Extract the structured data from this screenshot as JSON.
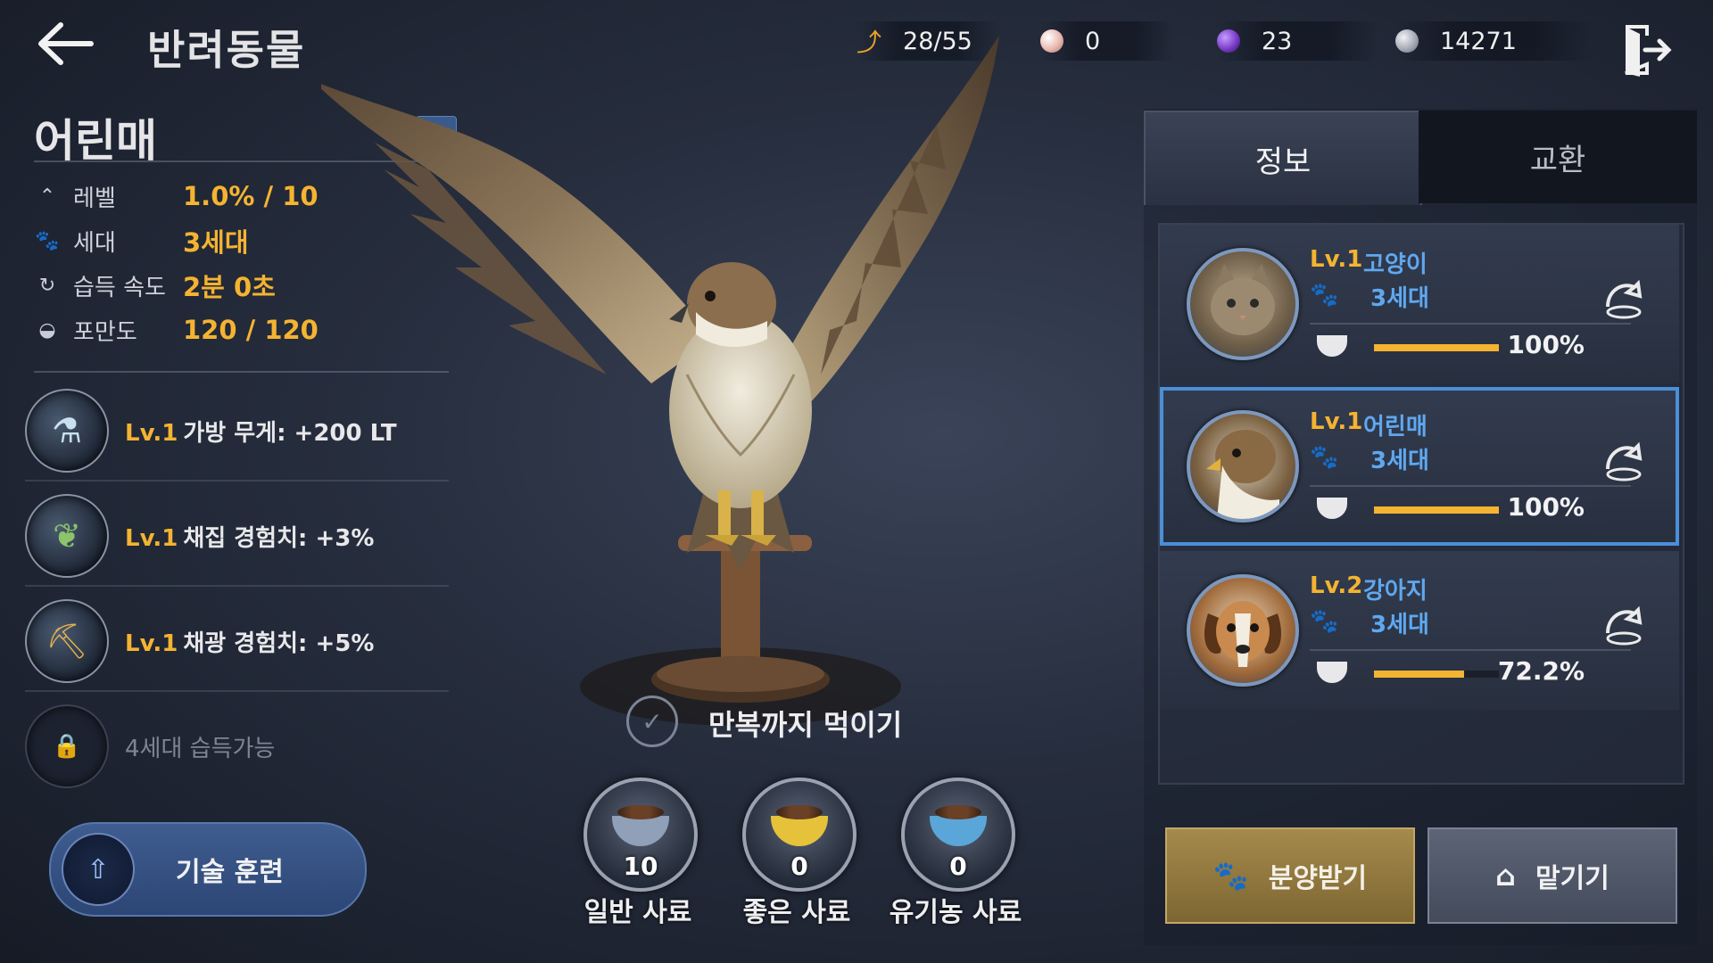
{
  "header": {
    "title": "반려동물",
    "currencies": [
      {
        "icon": "energy-icon",
        "value": "28/55",
        "color": "#e8a22a"
      },
      {
        "icon": "pearl-icon",
        "value": "0",
        "color": "#e9b9b0"
      },
      {
        "icon": "purple-gem-icon",
        "value": "23",
        "color": "#7a3cc8"
      },
      {
        "icon": "silver-coin-icon",
        "value": "14271",
        "color": "#9ea4b0"
      }
    ]
  },
  "pet": {
    "name": "어린매",
    "stats": [
      {
        "icon": "level-chevron-icon",
        "label": "레벨",
        "value": "1.0% / 10"
      },
      {
        "icon": "paw-icon",
        "label": "세대",
        "value": "3세대"
      },
      {
        "icon": "refresh-icon",
        "label": "습득 속도",
        "value": "2분 0초"
      },
      {
        "icon": "food-bowl-icon",
        "label": "포만도",
        "value": "120 / 120"
      }
    ],
    "skills": [
      {
        "lv": "Lv.1",
        "text": "가방 무게: +200 LT",
        "icon": "bag-weight-skill-icon"
      },
      {
        "lv": "Lv.1",
        "text": "채집 경험치: +3%",
        "icon": "gathering-skill-icon"
      },
      {
        "lv": "Lv.1",
        "text": "채광 경험치: +5%",
        "icon": "mining-skill-icon"
      },
      {
        "lv": "",
        "text": "4세대 습득가능",
        "icon": "lock-icon"
      }
    ],
    "train_label": "기술 훈련"
  },
  "feeding": {
    "auto_feed_label": "만복까지 먹이기",
    "foods": [
      {
        "name": "일반 사료",
        "count": "10",
        "color": "#8fa0b8"
      },
      {
        "name": "좋은 사료",
        "count": "0",
        "color": "#e6c23a"
      },
      {
        "name": "유기농 사료",
        "count": "0",
        "color": "#5aa6d8"
      }
    ]
  },
  "tabs": {
    "info": "정보",
    "exchange": "교환"
  },
  "pet_list": [
    {
      "lv": "Lv.1",
      "name": "고양이",
      "generation": "3세대",
      "satiety": "100%",
      "fill": 1.0,
      "selected": false,
      "portrait": "cat"
    },
    {
      "lv": "Lv.1",
      "name": "어린매",
      "generation": "3세대",
      "satiety": "100%",
      "fill": 1.0,
      "selected": true,
      "portrait": "hawk"
    },
    {
      "lv": "Lv.2",
      "name": "강아지",
      "generation": "3세대",
      "satiety": "72.2%",
      "fill": 0.722,
      "selected": false,
      "portrait": "dog"
    }
  ],
  "actions": {
    "adopt": "분양받기",
    "store": "맡기기"
  }
}
